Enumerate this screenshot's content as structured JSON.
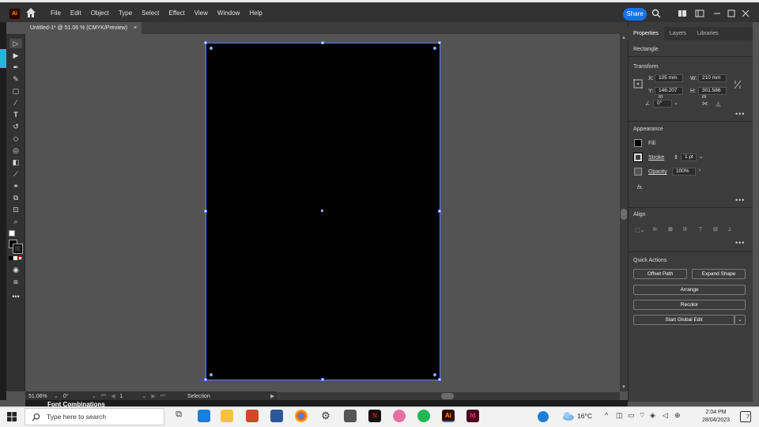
{
  "app": {
    "logo": "Ai"
  },
  "menu": [
    "File",
    "Edit",
    "Object",
    "Type",
    "Select",
    "Effect",
    "View",
    "Window",
    "Help"
  ],
  "share_label": "Share",
  "document_tab": {
    "title": "Untitled-1* @ 51.06 % (CMYK/Preview)",
    "close": "×"
  },
  "status": {
    "zoom": "51.06%",
    "rotation": "0°",
    "artboard": "1",
    "tool": "Selection"
  },
  "panel_tabs": [
    "Properties",
    "Layers",
    "Libraries"
  ],
  "properties": {
    "object_type": "Rectangle",
    "transform_title": "Transform",
    "x_label": "X:",
    "x_value": "105 mm",
    "w_label": "W:",
    "w_value": "210 mm",
    "y_label": "Y:",
    "y_value": "146.207 m",
    "h_label": "H:",
    "h_value": "301.586 m",
    "rotate_value": "0°",
    "appearance_title": "Appearance",
    "fill_label": "Fill",
    "stroke_label": "Stroke",
    "stroke_value": "1 pt",
    "opacity_label": "Opacity",
    "opacity_value": "100%",
    "fx_label": "fx.",
    "align_title": "Align",
    "quick_actions_title": "Quick Actions",
    "offset_path": "Offset Path",
    "expand_shape": "Expand Shape",
    "arrange": "Arrange",
    "recolor": "Recolor",
    "global_edit": "Start Global Edit",
    "more": "•••"
  },
  "behind_text": "Font Combinations",
  "taskbar": {
    "search_placeholder": "Type here to search",
    "weather": "16°C",
    "time": "2:04 PM",
    "date": "28/04/2023",
    "notification_count": "7"
  },
  "colors": {
    "accent": "#1473e6",
    "selection": "#5a7bff"
  }
}
